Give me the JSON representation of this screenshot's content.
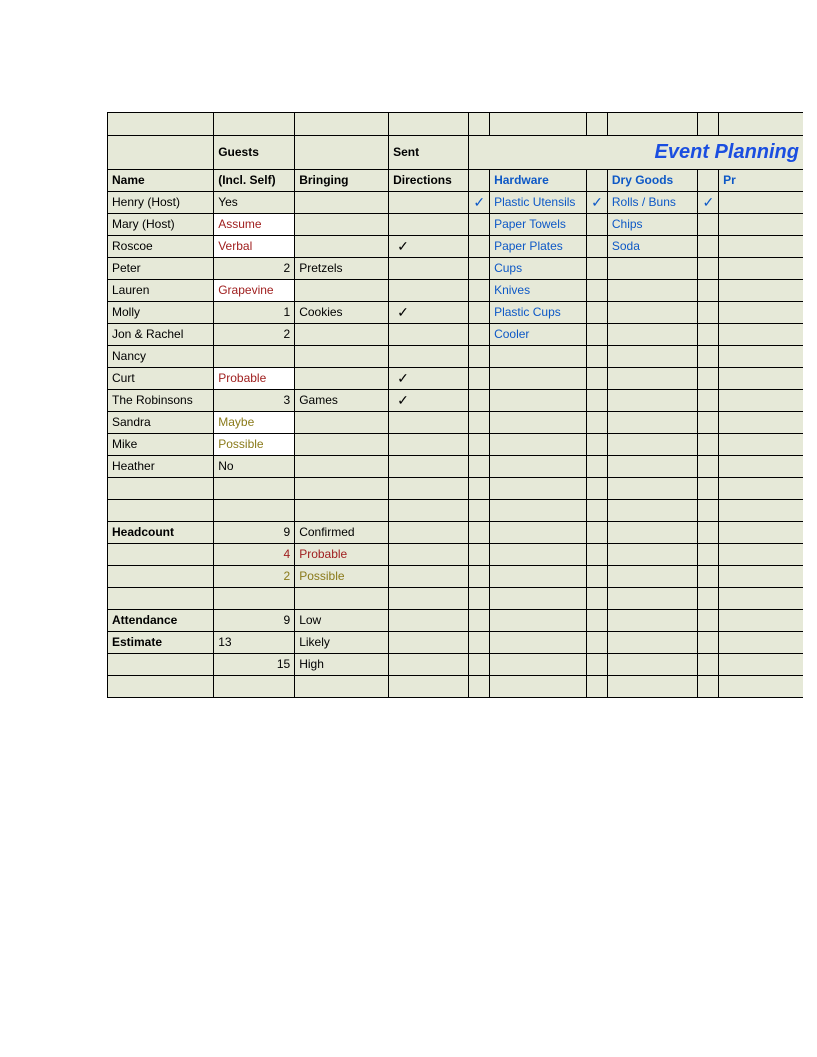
{
  "title": "Event Planning",
  "headers": {
    "guests": "Guests",
    "sent": "Sent",
    "name": "Name",
    "inclSelf": "(Incl. Self)",
    "bringing": "Bringing",
    "directions": "Directions",
    "hardware": "Hardware",
    "drygoods": "Dry Goods",
    "pr": "Pr"
  },
  "guests": [
    {
      "name": "Henry (Host)",
      "incl": "Yes",
      "bringing": "",
      "dir": ""
    },
    {
      "name": "Mary (Host)",
      "incl": "Assume",
      "inclClass": "white red",
      "bringing": "",
      "dir": ""
    },
    {
      "name": "Roscoe",
      "incl": "Verbal",
      "inclClass": "white red",
      "bringing": "",
      "dir": "✓"
    },
    {
      "name": "Peter",
      "incl": "2",
      "inclClass": "num",
      "bringing": "Pretzels",
      "dir": ""
    },
    {
      "name": "Lauren",
      "incl": "Grapevine",
      "inclClass": "white red",
      "bringing": "",
      "dir": ""
    },
    {
      "name": "Molly",
      "incl": "1",
      "inclClass": "num",
      "bringing": "Cookies",
      "dir": "✓"
    },
    {
      "name": "Jon & Rachel",
      "incl": "2",
      "inclClass": "num",
      "bringing": "",
      "dir": ""
    },
    {
      "name": "Nancy",
      "incl": "",
      "bringing": "",
      "dir": ""
    },
    {
      "name": "Curt",
      "incl": "Probable",
      "inclClass": "white red",
      "bringing": "",
      "dir": "✓"
    },
    {
      "name": "The Robinsons",
      "incl": "3",
      "inclClass": "num",
      "bringing": "Games",
      "dir": "✓"
    },
    {
      "name": "Sandra",
      "incl": "Maybe",
      "inclClass": "white olive",
      "bringing": "",
      "dir": ""
    },
    {
      "name": "Mike",
      "incl": "Possible",
      "inclClass": "white olive",
      "bringing": "",
      "dir": ""
    },
    {
      "name": "Heather",
      "incl": "No",
      "bringing": "",
      "dir": ""
    }
  ],
  "hardware": [
    {
      "chk": "✓",
      "item": "Plastic Utensils"
    },
    {
      "chk": "",
      "item": "Paper Towels"
    },
    {
      "chk": "",
      "item": "Paper Plates"
    },
    {
      "chk": "",
      "item": "Cups"
    },
    {
      "chk": "",
      "item": "Knives"
    },
    {
      "chk": "",
      "item": "Plastic Cups"
    },
    {
      "chk": "",
      "item": "Cooler"
    }
  ],
  "drygoods": [
    {
      "chk": "✓",
      "item": "Rolls / Buns"
    },
    {
      "chk": "",
      "item": "Chips"
    },
    {
      "chk": "",
      "item": "Soda"
    }
  ],
  "pr": [
    {
      "chk": "✓"
    }
  ],
  "summary": {
    "headcount_label": "Headcount",
    "headcount_val": "9",
    "confirmed": "Confirmed",
    "probable_val": "4",
    "probable": "Probable",
    "possible_val": "2",
    "possible": "Possible",
    "attendance_label": "Attendance",
    "attendance_val": "9",
    "low": "Low",
    "estimate_label": "Estimate",
    "estimate_val": "13",
    "likely": "Likely",
    "high_val": "15",
    "high": "High"
  }
}
